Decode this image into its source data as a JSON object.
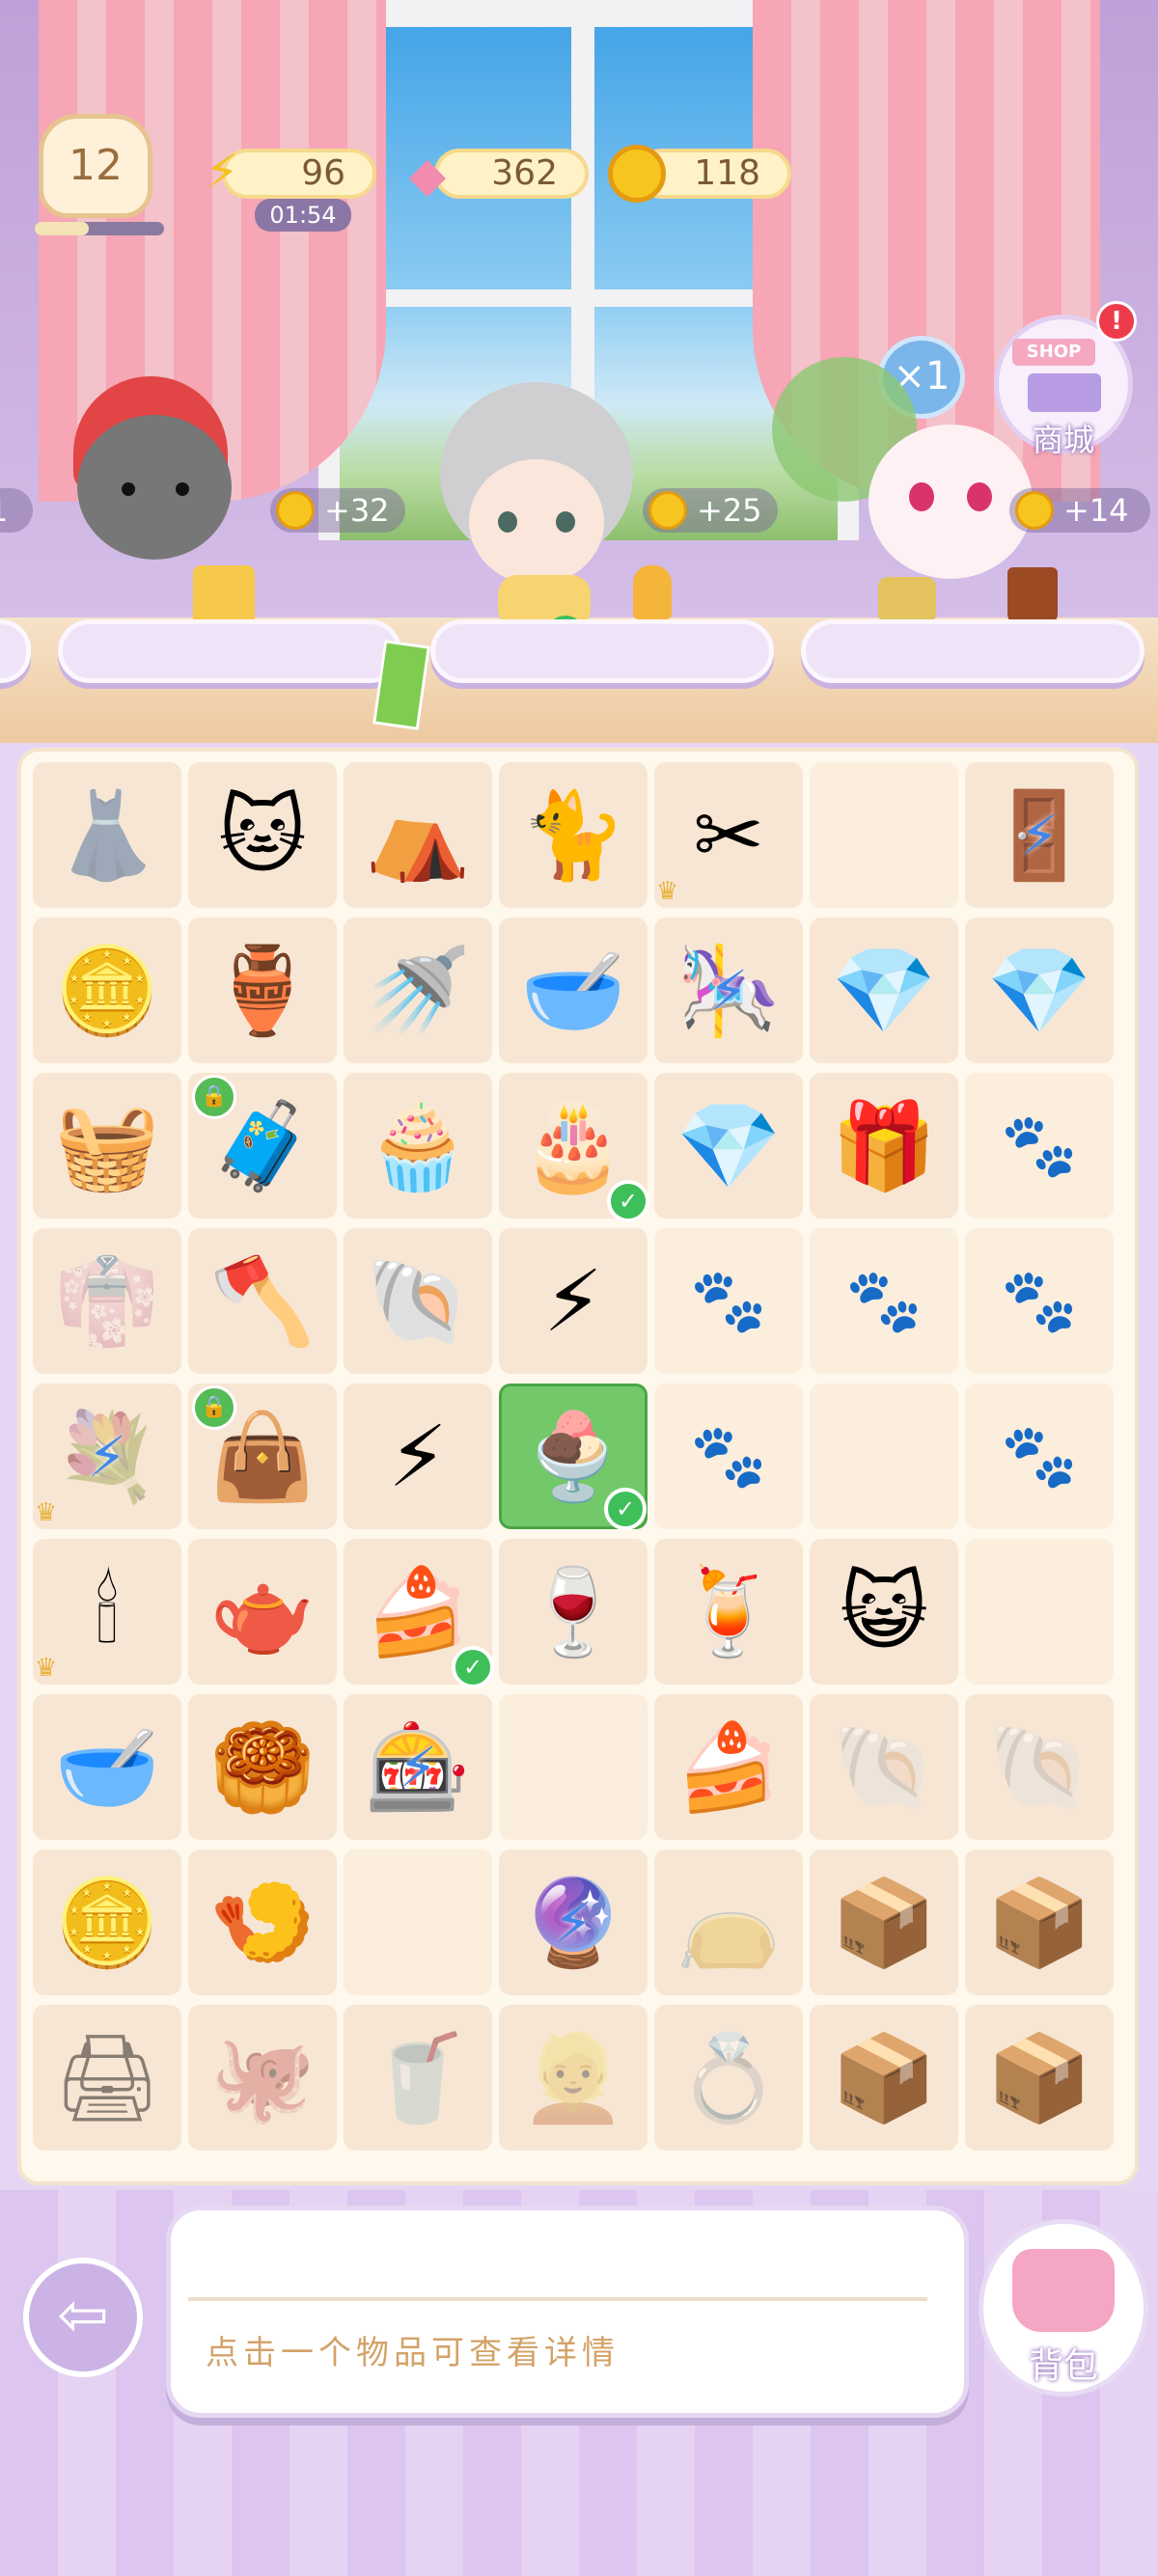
{
  "hud": {
    "level": "12",
    "energy": "96",
    "energy_timer": "01:54",
    "gems": "362",
    "coins": "118"
  },
  "shop": {
    "label": "商城",
    "sign": "SHOP",
    "alert": "!"
  },
  "multiplier": "×1",
  "customers": [
    {
      "reward": "+32",
      "name": "cat-customer"
    },
    {
      "reward": "+25",
      "name": "grandma-customer"
    },
    {
      "reward": "+14",
      "name": "bunny-customer"
    }
  ],
  "left_edge_reward": "1",
  "board": {
    "rows": [
      [
        "dress",
        "cat-calico",
        "tent",
        "cat-orange",
        "scissors",
        "empty",
        "wardrobe"
      ],
      [
        "coins",
        "jar",
        "watering-can",
        "bowl",
        "swing",
        "gems",
        "gem"
      ],
      [
        "garden-tools",
        "lunchbox",
        "cupcake",
        "cake",
        "gem-pile",
        "chest",
        "paw"
      ],
      [
        "robe",
        "shovel",
        "pearl",
        "energy",
        "paw",
        "paw",
        "paw"
      ],
      [
        "flower-stand",
        "bag",
        "energy-double",
        "parfait",
        "paw",
        "empty",
        "paw"
      ],
      [
        "candelabra",
        "pitcher",
        "cake2",
        "glass",
        "lemonade",
        "cat-plush",
        "empty"
      ],
      [
        "pet-bowl",
        "pastry",
        "vending",
        "empty",
        "cake-slice",
        "shell",
        "shell2"
      ],
      [
        "gold-coin",
        "fish-plate",
        "empty",
        "crystal-ball",
        "bag2",
        "box",
        "box"
      ],
      [
        "printer",
        "octopus",
        "drink",
        "wig",
        "earrings",
        "box",
        "box"
      ]
    ]
  },
  "info": {
    "hint": "点击一个物品可查看详情"
  },
  "backpack": {
    "label": "背包"
  }
}
